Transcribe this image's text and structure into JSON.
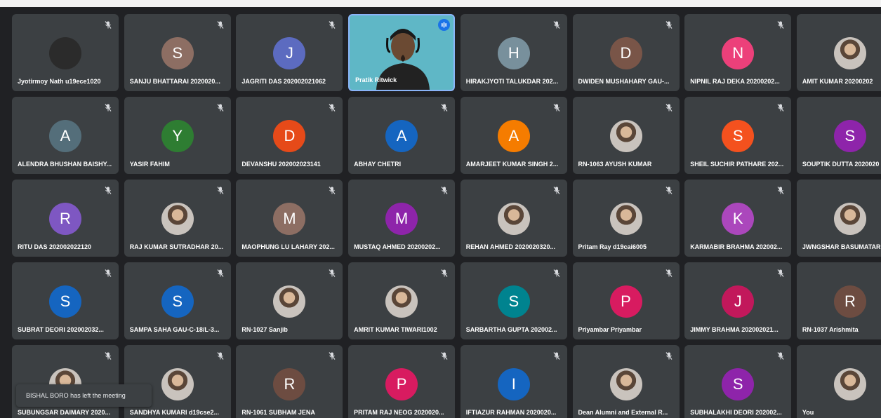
{
  "app": {
    "notification": "BISHAL BORO has left the meeting"
  },
  "colors": {
    "tile_bg": "#3c4043",
    "page_bg": "#202124",
    "speaking_border": "#8ab4f8",
    "video_bg": "#5fb7c6"
  },
  "participants": [
    {
      "name": "Jyotirmoy Nath u19ece1020",
      "initial": "",
      "color": "#2b2b2b",
      "muted": true
    },
    {
      "name": "SANJU BHATTARAI 2020020...",
      "initial": "S",
      "color": "#8d6e63",
      "muted": true
    },
    {
      "name": "JAGRITI DAS 202002021062",
      "initial": "J",
      "color": "#5c6bc0",
      "muted": true
    },
    {
      "name": "Pratik Ritwick",
      "initial": "",
      "color": "#5fb7c6",
      "muted": false,
      "video": true
    },
    {
      "name": "HIRAKJYOTI TALUKDAR 202...",
      "initial": "H",
      "color": "#78909c",
      "muted": true
    },
    {
      "name": "DWIDEN MUSHAHARY GAU-...",
      "initial": "D",
      "color": "#795548",
      "muted": true
    },
    {
      "name": "NIPNIL RAJ DEKA 20200202...",
      "initial": "N",
      "color": "#ec407a",
      "muted": true
    },
    {
      "name": "AMIT KUMAR 20200202",
      "initial": "",
      "color": "#d7a86e",
      "muted": true,
      "photo": true
    },
    {
      "name": "ALENDRA BHUSHAN BAISHY...",
      "initial": "A",
      "color": "#546e7a",
      "muted": true
    },
    {
      "name": "YASIR FAHIM",
      "initial": "Y",
      "color": "#2e7d32",
      "muted": true
    },
    {
      "name": "DEVANSHU 202002023141",
      "initial": "D",
      "color": "#e64a19",
      "muted": true
    },
    {
      "name": "ABHAY CHETRI",
      "initial": "A",
      "color": "#1565c0",
      "muted": true
    },
    {
      "name": "AMARJEET KUMAR SINGH 2...",
      "initial": "A",
      "color": "#f57c00",
      "muted": true
    },
    {
      "name": "RN-1063 AYUSH KUMAR",
      "initial": "",
      "color": "#a1887f",
      "muted": true,
      "photo": true
    },
    {
      "name": "SHEIL SUCHIR PATHARE 202...",
      "initial": "S",
      "color": "#f4511e",
      "muted": true
    },
    {
      "name": "SOUPTIK DUTTA 2020020",
      "initial": "S",
      "color": "#8e24aa",
      "muted": true
    },
    {
      "name": "RITU DAS 202002022120",
      "initial": "R",
      "color": "#7e57c2",
      "muted": true
    },
    {
      "name": "RAJ KUMAR SUTRADHAR 20...",
      "initial": "",
      "color": "#e53935",
      "muted": true,
      "photo": true
    },
    {
      "name": "MAOPHUNG LU LAHARY 202...",
      "initial": "M",
      "color": "#8d6e63",
      "muted": true
    },
    {
      "name": "MUSTAQ AHMED 20200202...",
      "initial": "M",
      "color": "#8e24aa",
      "muted": true
    },
    {
      "name": "REHAN AHMED 2020020320...",
      "initial": "",
      "color": "#90a4ae",
      "muted": true,
      "photo": true
    },
    {
      "name": "Pritam Ray d19cai6005",
      "initial": "",
      "color": "#bcaaa4",
      "muted": true,
      "photo": true
    },
    {
      "name": "KARMABIR BRAHMA 202002...",
      "initial": "K",
      "color": "#ab47bc",
      "muted": true
    },
    {
      "name": "JWNGSHAR BASUMATAR",
      "initial": "",
      "color": "#e91e63",
      "muted": true,
      "photo": true
    },
    {
      "name": "SUBRAT DEORI 202002032...",
      "initial": "S",
      "color": "#1565c0",
      "muted": true
    },
    {
      "name": "SAMPA SAHA GAU-C-18/L-3...",
      "initial": "S",
      "color": "#1565c0",
      "muted": true
    },
    {
      "name": "RN-1027 Sanjib",
      "initial": "",
      "color": "#7cb342",
      "muted": true,
      "photo": true
    },
    {
      "name": "AMRIT KUMAR TIWARI1002",
      "initial": "",
      "color": "#d7ccc8",
      "muted": true,
      "photo": true
    },
    {
      "name": "SARBARTHA GUPTA 202002...",
      "initial": "S",
      "color": "#00838f",
      "muted": true
    },
    {
      "name": "Priyambar Priyambar",
      "initial": "P",
      "color": "#d81b60",
      "muted": true
    },
    {
      "name": "JIMMY BRAHMA 202002021...",
      "initial": "J",
      "color": "#c2185b",
      "muted": true
    },
    {
      "name": "RN-1037 Arishmita",
      "initial": "R",
      "color": "#6d4c41",
      "muted": true
    },
    {
      "name": "SUBUNGSAR DAIMARY 2020...",
      "initial": "",
      "color": "#bcaaa4",
      "muted": true,
      "photo": true
    },
    {
      "name": "SANDHYA KUMARI d19cse2...",
      "initial": "",
      "color": "#8d6e63",
      "muted": true,
      "photo": true
    },
    {
      "name": "RN-1061 SUBHAM JENA",
      "initial": "R",
      "color": "#6d4c41",
      "muted": true
    },
    {
      "name": "PRITAM RAJ NEOG 2020020...",
      "initial": "P",
      "color": "#d81b60",
      "muted": true
    },
    {
      "name": "IFTIAZUR RAHMAN 2020020...",
      "initial": "I",
      "color": "#1565c0",
      "muted": true
    },
    {
      "name": "Dean Alumni and External R...",
      "initial": "",
      "color": "#424242",
      "muted": true,
      "photo": true
    },
    {
      "name": "SUBHALAKHI DEORI 202002...",
      "initial": "S",
      "color": "#8e24aa",
      "muted": true
    },
    {
      "name": "You",
      "initial": "",
      "color": "#bcaaa4",
      "muted": false,
      "photo": true
    }
  ]
}
